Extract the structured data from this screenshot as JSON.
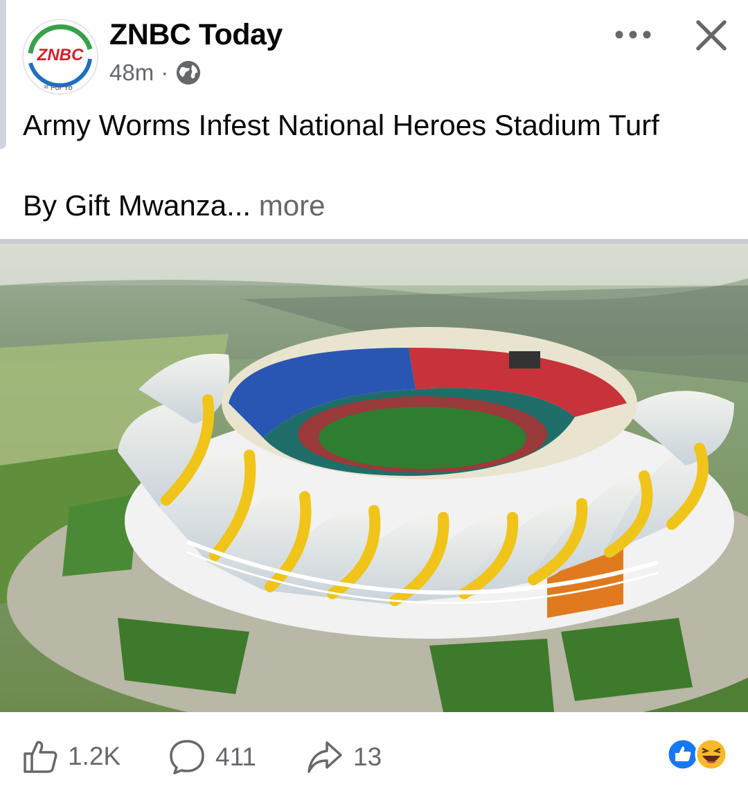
{
  "post": {
    "page_name": "ZNBC Today",
    "time": "48m",
    "separator": "·",
    "visibility_icon": "globe-icon",
    "headline": "Army Worms Infest National Heroes Stadium Turf",
    "byline": "By Gift Mwanza...",
    "more_label": "more"
  },
  "avatar": {
    "logo_text": "ZNBC",
    "tagline": "ᵃᵗ For Yo"
  },
  "actions": {
    "like_count": "1.2K",
    "comment_count": "411",
    "share_count": "13",
    "reaction_icons": [
      "like-reaction-icon",
      "haha-reaction-icon"
    ]
  },
  "colors": {
    "brand_red": "#d32027",
    "brand_blue": "#1877f2",
    "muted_text": "#65676b"
  }
}
